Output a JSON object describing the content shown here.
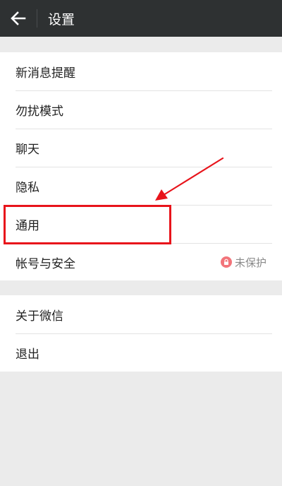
{
  "header": {
    "back_icon": "arrow-left-icon",
    "title": "设置"
  },
  "settings": {
    "group1": [
      {
        "label": "新消息提醒"
      },
      {
        "label": "勿扰模式"
      },
      {
        "label": "聊天"
      },
      {
        "label": "隐私"
      },
      {
        "label": "通用"
      },
      {
        "label": "帐号与安全",
        "status": "未保护",
        "status_icon": "lock-icon"
      }
    ],
    "group2": [
      {
        "label": "关于微信"
      },
      {
        "label": "退出"
      }
    ]
  },
  "annotation": {
    "highlighted_item": "通用",
    "color": "#e8141b"
  },
  "colors": {
    "header_bg": "#2e3132",
    "page_bg": "#ebebeb",
    "status_badge": "#f2747a"
  }
}
